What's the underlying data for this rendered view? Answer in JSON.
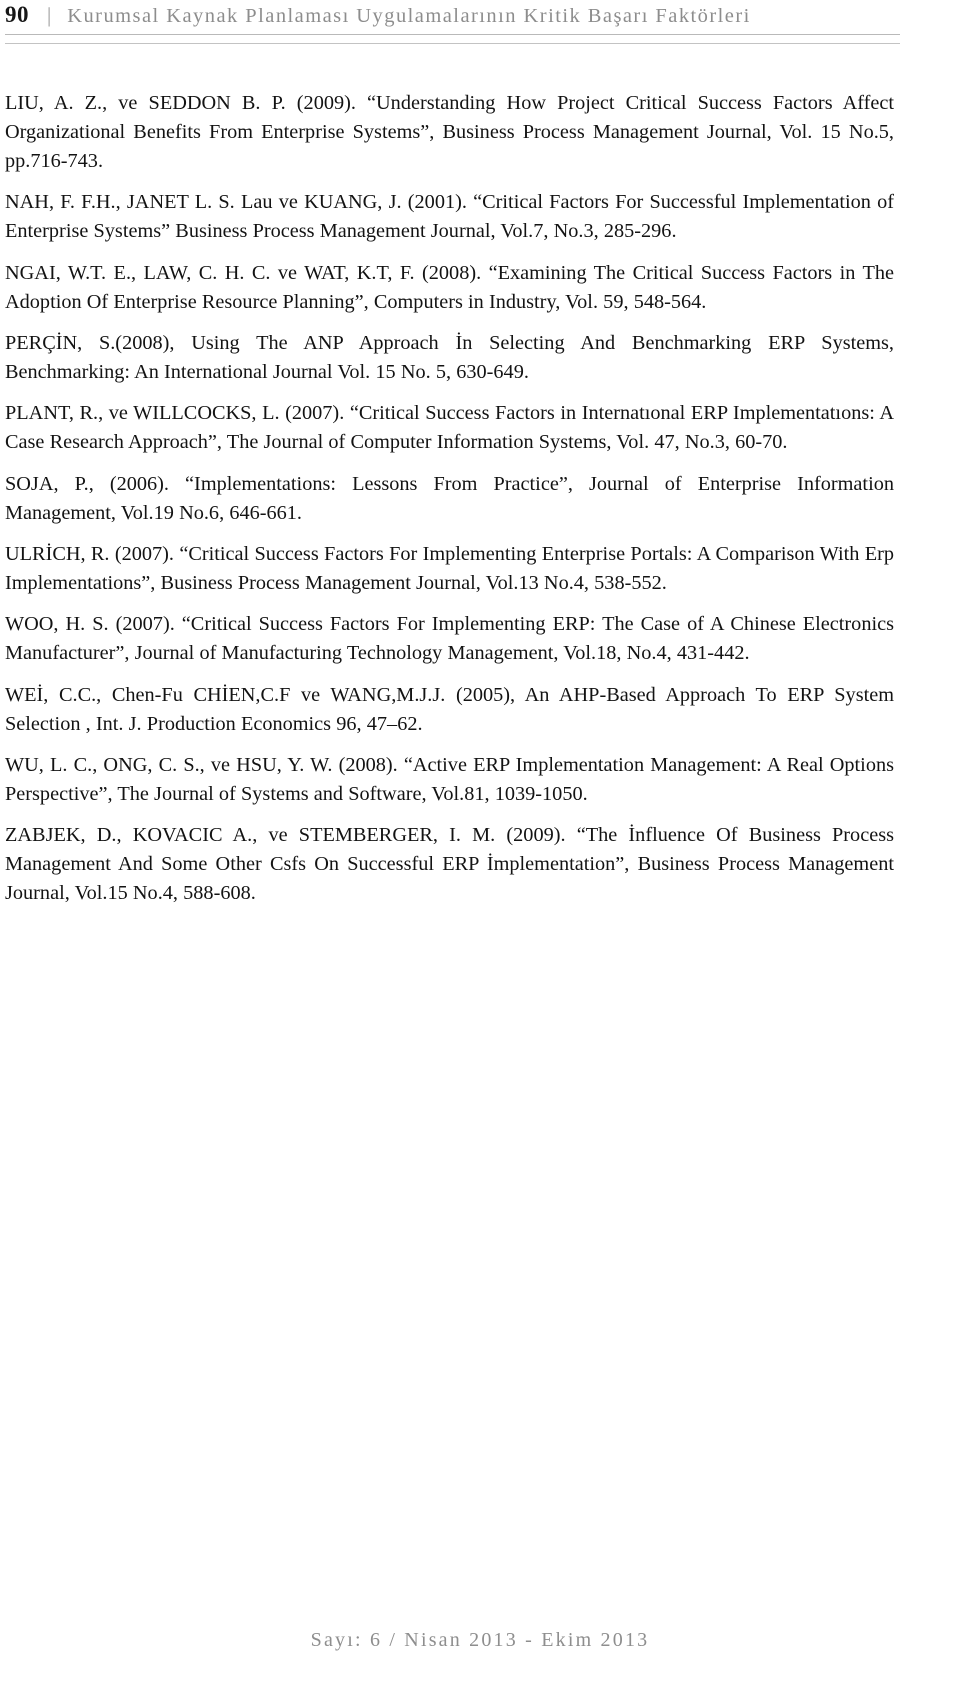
{
  "header": {
    "page_number": "90",
    "separator": "|",
    "title": "Kurumsal Kaynak Planlaması Uygulamalarının Kritik Başarı Faktörleri"
  },
  "references": [
    {
      "id": "liu-seddon-2009",
      "text": "LIU, A. Z., ve SEDDON B. P. (2009). “Understanding How Project Critical Success Factors Affect Organizational Benefits From Enterprise Systems”, Business Process Management Journal, Vol. 15 No.5, pp.716-743."
    },
    {
      "id": "nah-lau-kuang-2001",
      "text": "NAH, F. F.H., JANET L. S. Lau ve KUANG, J. (2001). “Critical Factors For Successful Implementation of Enterprise Systems” Business Process Management Journal, Vol.7, No.3, 285-296."
    },
    {
      "id": "ngai-law-wat-2008",
      "text": "NGAI, W.T. E., LAW, C. H. C. ve WAT, K.T, F. (2008). “Examining The Critical Success Factors in The Adoption Of Enterprise Resource Planning”, Computers in Industry, Vol. 59, 548-564."
    },
    {
      "id": "percin-2008",
      "text": "PERÇİN, S.(2008), Using The ANP Approach İn Selecting And Benchmarking ERP Systems, Benchmarking: An International Journal Vol. 15 No. 5, 630-649."
    },
    {
      "id": "plant-willcocks-2007",
      "text": "PLANT, R., ve WILLCOCKS, L. (2007). “Critical Success Factors in Internatıonal ERP Implementatıons: A Case Research Approach”, The Journal of Computer Information Systems, Vol. 47, No.3, 60-70."
    },
    {
      "id": "soja-2006",
      "text": "SOJA, P., (2006). “Implementations: Lessons From Practice”, Journal of Enterprise Information Management, Vol.19 No.6, 646-661."
    },
    {
      "id": "ulrich-2007",
      "text": "ULRİCH, R. (2007). “Critical Success Factors For Implementing Enterprise Portals: A Comparison With Erp Implementations”, Business Process Management Journal, Vol.13 No.4, 538-552."
    },
    {
      "id": "woo-2007",
      "text": "WOO, H. S. (2007). “Critical Success Factors For Implementing ERP: The Case of A Chinese Electronics Manufacturer”, Journal of Manufacturing Technology Management, Vol.18, No.4, 431-442."
    },
    {
      "id": "wei-chien-wang-2005",
      "text": "WEİ, C.C.,  Chen-Fu CHİEN,C.F ve WANG,M.J.J. (2005), An AHP-Based Approach To ERP System Selection , Int. J. Production Economics 96, 47–62."
    },
    {
      "id": "wu-ong-hsu-2008",
      "text": "WU, L. C., ONG, C. S., ve HSU, Y. W. (2008). “Active ERP Implementation Management: A Real Options Perspective”, The Journal of Systems and Software, Vol.81, 1039-1050."
    },
    {
      "id": "zabjek-kovacic-stemberger-2009",
      "text": "ZABJEK, D., KOVACIC A., ve STEMBERGER,  I. M. (2009). “The İnfluence Of Business Process Management And Some Other Csfs On Successful ERP İmplementation”, Business Process Management Journal, Vol.15 No.4, 588-608."
    }
  ],
  "footer": {
    "text": "Sayı: 6 / Nisan 2013 - Ekim 2013"
  },
  "colors": {
    "body_text": "#131313",
    "header_title": "#8d8d8d",
    "folio": "#161616",
    "rule": "#b9b9b9",
    "footer_text": "#8e8e8e",
    "page_background": "#ffffff"
  }
}
